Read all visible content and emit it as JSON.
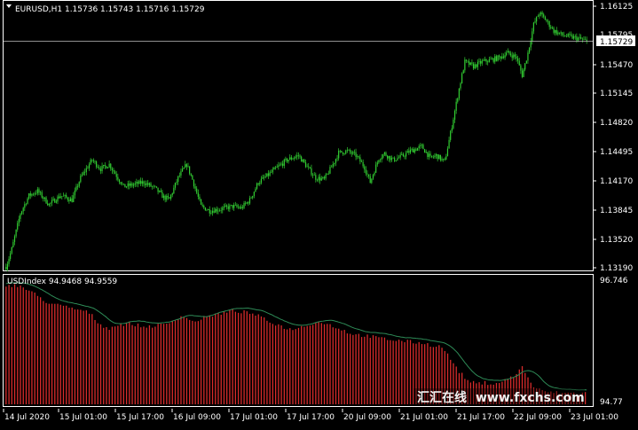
{
  "colors": {
    "background": "#000000",
    "frame": "#ffffff",
    "candle": "#32cd32",
    "histogram": "#d72b2b",
    "ma_line": "#2e8b57",
    "text": "#ffffff"
  },
  "main_panel": {
    "symbol_header": "EURUSD,H1  1.15736 1.15743 1.15716 1.15729",
    "price_axis_labels": [
      "1.16125",
      "1.15795",
      "1.15470",
      "1.15145",
      "1.14820",
      "1.14495",
      "1.14170",
      "1.13845",
      "1.13520",
      "1.13190"
    ],
    "current_price_label": "1.15729",
    "current_price": 1.15729
  },
  "indicator_panel": {
    "header": "USDIndex 94.9468 94.9559",
    "axis_top_label": "96.746",
    "axis_bottom_label": "94.77"
  },
  "time_axis": {
    "labels": [
      "14 Jul 2020",
      "15 Jul 01:00",
      "15 Jul 17:00",
      "16 Jul 09:00",
      "17 Jul 01:00",
      "17 Jul 17:00",
      "20 Jul 09:00",
      "21 Jul 01:00",
      "21 Jul 17:00",
      "22 Jul 09:00",
      "23 Jul 01:00"
    ]
  },
  "watermark": {
    "chinese": "汇汇在线",
    "url": "www.fxchs.com"
  },
  "chart_data": {
    "type": "candlestick",
    "price_ylim": [
      1.1319,
      1.16125
    ],
    "indicator_ylim": [
      94.77,
      96.746
    ],
    "close_path": [
      [
        0,
        1.132
      ],
      [
        4,
        1.134
      ],
      [
        10,
        1.138
      ],
      [
        16,
        1.14
      ],
      [
        22,
        1.1405
      ],
      [
        30,
        1.139
      ],
      [
        38,
        1.14
      ],
      [
        46,
        1.1395
      ],
      [
        52,
        1.142
      ],
      [
        60,
        1.144
      ],
      [
        66,
        1.143
      ],
      [
        72,
        1.1435
      ],
      [
        78,
        1.142
      ],
      [
        82,
        1.141
      ],
      [
        88,
        1.1412
      ],
      [
        96,
        1.1415
      ],
      [
        104,
        1.1408
      ],
      [
        110,
        1.1398
      ],
      [
        114,
        1.1396
      ],
      [
        120,
        1.142
      ],
      [
        126,
        1.1435
      ],
      [
        130,
        1.1418
      ],
      [
        136,
        1.1388
      ],
      [
        142,
        1.1383
      ],
      [
        150,
        1.1385
      ],
      [
        158,
        1.1388
      ],
      [
        164,
        1.1386
      ],
      [
        170,
        1.1395
      ],
      [
        176,
        1.1415
      ],
      [
        182,
        1.1422
      ],
      [
        188,
        1.143
      ],
      [
        196,
        1.144
      ],
      [
        204,
        1.1445
      ],
      [
        210,
        1.1432
      ],
      [
        216,
        1.142
      ],
      [
        222,
        1.1418
      ],
      [
        228,
        1.1435
      ],
      [
        232,
        1.1448
      ],
      [
        238,
        1.145
      ],
      [
        244,
        1.1445
      ],
      [
        250,
        1.1432
      ],
      [
        254,
        1.1415
      ],
      [
        260,
        1.1442
      ],
      [
        264,
        1.1447
      ],
      [
        270,
        1.144
      ],
      [
        276,
        1.1444
      ],
      [
        282,
        1.145
      ],
      [
        290,
        1.1455
      ],
      [
        296,
        1.1442
      ],
      [
        300,
        1.1445
      ],
      [
        306,
        1.1438
      ],
      [
        310,
        1.147
      ],
      [
        316,
        1.152
      ],
      [
        320,
        1.155
      ],
      [
        326,
        1.1545
      ],
      [
        332,
        1.155
      ],
      [
        338,
        1.1552
      ],
      [
        344,
        1.1555
      ],
      [
        350,
        1.156
      ],
      [
        356,
        1.1555
      ],
      [
        360,
        1.1535
      ],
      [
        364,
        1.156
      ],
      [
        368,
        1.1592
      ],
      [
        372,
        1.1605
      ],
      [
        376,
        1.1598
      ],
      [
        382,
        1.1585
      ],
      [
        388,
        1.158
      ],
      [
        394,
        1.1578
      ],
      [
        400,
        1.1576
      ],
      [
        405,
        1.15729
      ]
    ],
    "usd_index_path": [
      [
        0,
        96.7
      ],
      [
        10,
        96.68
      ],
      [
        20,
        96.55
      ],
      [
        30,
        96.4
      ],
      [
        40,
        96.35
      ],
      [
        50,
        96.3
      ],
      [
        58,
        96.25
      ],
      [
        66,
        96.05
      ],
      [
        72,
        96.0
      ],
      [
        78,
        96.05
      ],
      [
        86,
        96.08
      ],
      [
        96,
        96.02
      ],
      [
        104,
        96.04
      ],
      [
        112,
        96.06
      ],
      [
        118,
        96.15
      ],
      [
        124,
        96.2
      ],
      [
        130,
        96.1
      ],
      [
        136,
        96.15
      ],
      [
        142,
        96.2
      ],
      [
        150,
        96.24
      ],
      [
        158,
        96.28
      ],
      [
        166,
        96.26
      ],
      [
        174,
        96.22
      ],
      [
        182,
        96.12
      ],
      [
        190,
        96.05
      ],
      [
        198,
        95.98
      ],
      [
        206,
        96.02
      ],
      [
        214,
        96.08
      ],
      [
        220,
        96.1
      ],
      [
        226,
        96.05
      ],
      [
        234,
        95.98
      ],
      [
        242,
        95.9
      ],
      [
        250,
        95.88
      ],
      [
        258,
        95.85
      ],
      [
        266,
        95.82
      ],
      [
        274,
        95.8
      ],
      [
        282,
        95.78
      ],
      [
        290,
        95.76
      ],
      [
        298,
        95.72
      ],
      [
        304,
        95.7
      ],
      [
        310,
        95.5
      ],
      [
        316,
        95.3
      ],
      [
        322,
        95.15
      ],
      [
        328,
        95.1
      ],
      [
        334,
        95.12
      ],
      [
        340,
        95.1
      ],
      [
        346,
        95.14
      ],
      [
        352,
        95.2
      ],
      [
        356,
        95.25
      ],
      [
        360,
        95.38
      ],
      [
        364,
        95.2
      ],
      [
        368,
        95.05
      ],
      [
        374,
        94.98
      ],
      [
        382,
        94.96
      ],
      [
        390,
        94.95
      ],
      [
        398,
        94.95
      ],
      [
        405,
        94.95
      ]
    ]
  }
}
